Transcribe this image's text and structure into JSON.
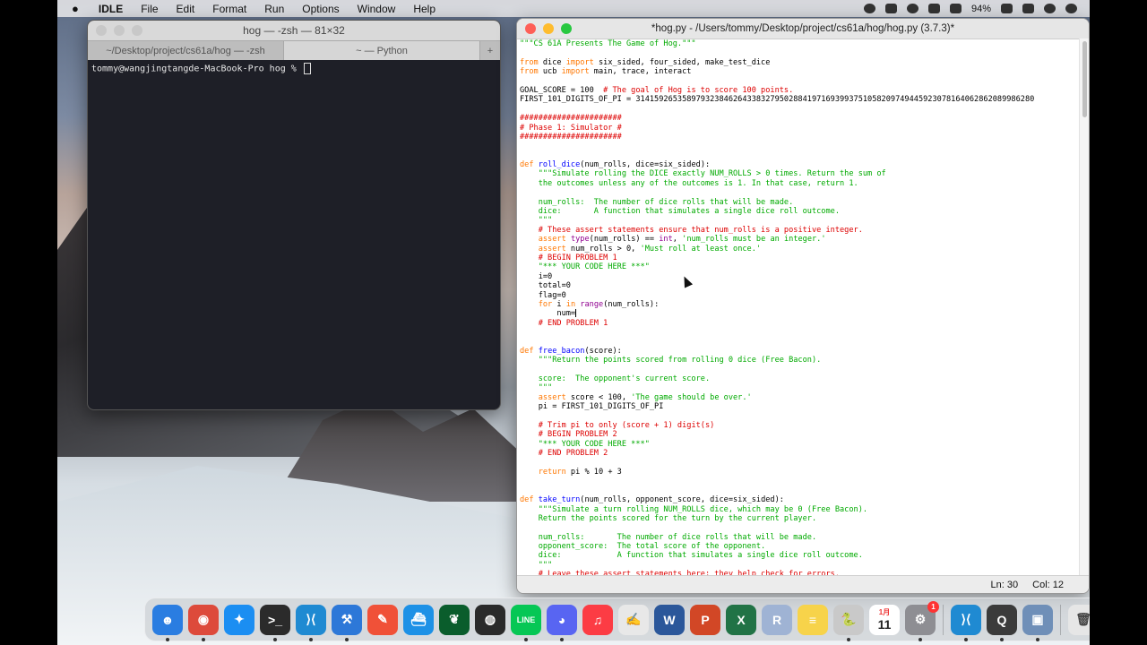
{
  "menubar": {
    "app": "IDLE",
    "items": [
      "File",
      "Edit",
      "Format",
      "Run",
      "Options",
      "Window",
      "Help"
    ],
    "battery": "94%"
  },
  "terminal": {
    "title": "hog — -zsh — 81×32",
    "tabs": [
      "~/Desktop/project/cs61a/hog — -zsh",
      "~ — Python"
    ],
    "prompt": "tommy@wangjingtangde-MacBook-Pro hog % "
  },
  "idle": {
    "title": "*hog.py - /Users/tommy/Desktop/project/cs61a/hog/hog.py (3.7.3)*",
    "status_ln": "Ln: 30",
    "status_col": "Col: 12",
    "code": [
      "\"\"\"CS 61A Presents The Game of Hog.\"\"\"",
      "",
      "from dice import six_sided, four_sided, make_test_dice",
      "from ucb import main, trace, interact",
      "",
      "GOAL_SCORE = 100  # The goal of Hog is to score 100 points.",
      "FIRST_101_DIGITS_OF_PI = 31415926535897932384626433832795028841971693993751058209749445923078164062862089986280",
      "",
      "######################",
      "# Phase 1: Simulator #",
      "######################",
      "",
      "",
      "def roll_dice(num_rolls, dice=six_sided):",
      "    \"\"\"Simulate rolling the DICE exactly NUM_ROLLS > 0 times. Return the sum of",
      "    the outcomes unless any of the outcomes is 1. In that case, return 1.",
      "",
      "    num_rolls:  The number of dice rolls that will be made.",
      "    dice:       A function that simulates a single dice roll outcome.",
      "    \"\"\"",
      "    # These assert statements ensure that num_rolls is a positive integer.",
      "    assert type(num_rolls) == int, 'num_rolls must be an integer.'",
      "    assert num_rolls > 0, 'Must roll at least once.'",
      "    # BEGIN PROBLEM 1",
      "    \"*** YOUR CODE HERE ***\"",
      "    i=0",
      "    total=0",
      "    flag=0",
      "    for i in range(num_rolls):",
      "        num=",
      "    # END PROBLEM 1",
      "",
      "",
      "def free_bacon(score):",
      "    \"\"\"Return the points scored from rolling 0 dice (Free Bacon).",
      "",
      "    score:  The opponent's current score.",
      "    \"\"\"",
      "    assert score < 100, 'The game should be over.'",
      "    pi = FIRST_101_DIGITS_OF_PI",
      "",
      "    # Trim pi to only (score + 1) digit(s)",
      "    # BEGIN PROBLEM 2",
      "    \"*** YOUR CODE HERE ***\"",
      "    # END PROBLEM 2",
      "",
      "    return pi % 10 + 3",
      "",
      "",
      "def take_turn(num_rolls, opponent_score, dice=six_sided):",
      "    \"\"\"Simulate a turn rolling NUM_ROLLS dice, which may be 0 (Free Bacon).",
      "    Return the points scored for the turn by the current player.",
      "",
      "    num_rolls:       The number of dice rolls that will be made.",
      "    opponent_score:  The total score of the opponent.",
      "    dice:            A function that simulates a single dice roll outcome.",
      "    \"\"\"",
      "    # Leave these assert statements here; they help check for errors."
    ]
  },
  "dock": {
    "calendar_month": "1月",
    "calendar_day": "11",
    "settings_badge": "1",
    "apps": [
      {
        "name": "finder-icon",
        "color": "#2a7de1",
        "glyph": "☻"
      },
      {
        "name": "chrome-icon",
        "color": "#dd4a3b",
        "glyph": "◉"
      },
      {
        "name": "safari-icon",
        "color": "#1b8ef2",
        "glyph": "✦"
      },
      {
        "name": "terminal-icon",
        "color": "#2b2b2b",
        "glyph": ">_"
      },
      {
        "name": "vscode-icon",
        "color": "#1f8ad2",
        "glyph": "⟩⟨"
      },
      {
        "name": "xcode-icon",
        "color": "#2d78d8",
        "glyph": "⚒"
      },
      {
        "name": "swift-playgrounds-icon",
        "color": "#f05138",
        "glyph": "✎"
      },
      {
        "name": "docker-icon",
        "color": "#1d91e6",
        "glyph": "⛴"
      },
      {
        "name": "mongodb-icon",
        "color": "#0a5d2c",
        "glyph": "❦"
      },
      {
        "name": "wechat-icon",
        "color": "#2a2a2a",
        "glyph": "◍"
      },
      {
        "name": "line-icon",
        "color": "#06c755",
        "glyph": "LINE"
      },
      {
        "name": "discord-icon",
        "color": "#5865f2",
        "glyph": "◕"
      },
      {
        "name": "music-icon",
        "color": "#fc3c44",
        "glyph": "♫"
      },
      {
        "name": "textedit-icon",
        "color": "#e8e8e8",
        "glyph": "✍"
      },
      {
        "name": "word-icon",
        "color": "#2b579a",
        "glyph": "W"
      },
      {
        "name": "powerpoint-icon",
        "color": "#d24726",
        "glyph": "P"
      },
      {
        "name": "excel-icon",
        "color": "#217346",
        "glyph": "X"
      },
      {
        "name": "r-icon",
        "color": "#9fb3d4",
        "glyph": "R"
      },
      {
        "name": "notes-icon",
        "color": "#f7d34a",
        "glyph": "≡"
      },
      {
        "name": "python-launcher-icon",
        "color": "#c9c9c9",
        "glyph": "🐍"
      },
      {
        "name": "calendar-icon",
        "color": "#ffffff",
        "glyph": ""
      },
      {
        "name": "system-preferences-icon",
        "color": "#8e8e93",
        "glyph": "⚙"
      }
    ],
    "running": [
      {
        "name": "vscode-icon",
        "color": "#1f8ad2",
        "glyph": "⟩⟨"
      },
      {
        "name": "quicktime-icon",
        "color": "#3b3b3b",
        "glyph": "Q"
      },
      {
        "name": "preview-icon",
        "color": "#6f8fb8",
        "glyph": "▣"
      }
    ],
    "trash": {
      "name": "trash-icon",
      "color": "#e6e6e6",
      "glyph": "🗑"
    }
  }
}
